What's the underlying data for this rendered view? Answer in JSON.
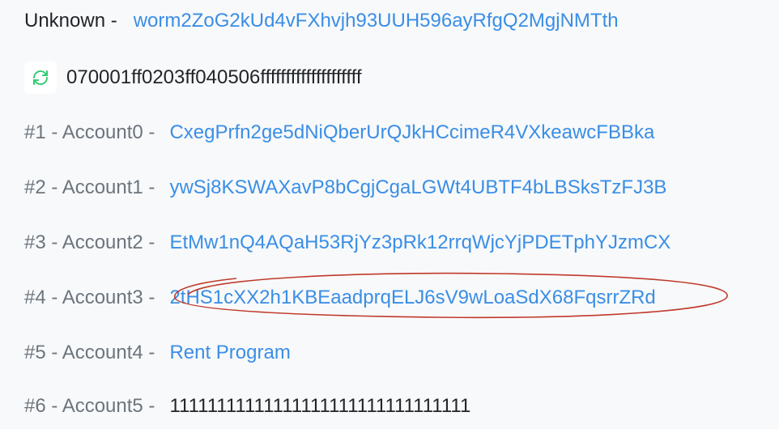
{
  "unknown": {
    "label": "Unknown -",
    "address": "worm2ZoG2kUd4vFXhvjh93UUH596ayRfgQ2MgjNMTth"
  },
  "data_row": {
    "icon": "refresh-icon",
    "value": "070001ff0203ff040506ffffffffffffffffffff"
  },
  "accounts": [
    {
      "label": "#1 - Account0 -",
      "value": "CxegPrfn2ge5dNiQberUrQJkHCcimeR4VXkeawcFBBka"
    },
    {
      "label": "#2 - Account1 -",
      "value": "ywSj8KSWAXavP8bCgjCgaLGWt4UBTF4bLBSksTzFJ3B"
    },
    {
      "label": "#3 - Account2 -",
      "value": "EtMw1nQ4AQaH53RjYz3pRk12rrqWjcYjPDETphYJzmCX"
    },
    {
      "label": "#4 - Account3 -",
      "value": "2tHS1cXX2h1KBEaadprqELJ6sV9wLoaSdX68FqsrrZRd"
    },
    {
      "label": "#5 - Account4 -",
      "value": "Rent Program"
    },
    {
      "label": "#6 - Account5 -",
      "value": "11111111111111111111111111111111"
    }
  ],
  "colors": {
    "link": "#3a8ee6",
    "highlight": "#c0392b",
    "refresh_icon": "#2ecc71"
  }
}
